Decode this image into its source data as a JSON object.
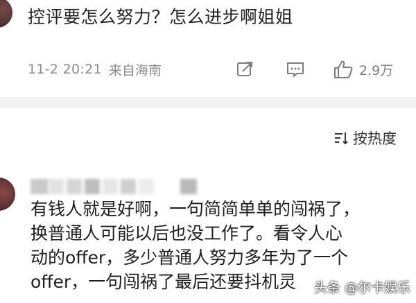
{
  "comment_top": {
    "text": "控评要怎么努力？怎么进步啊姐姐",
    "time": "11-2 20:21",
    "location": "来自海南",
    "like_count": "2.9万"
  },
  "sort": {
    "label": "按热度"
  },
  "comment_second": {
    "lines": [
      "有钱人就是好啊，一句简简单单的闯祸了，",
      "换普通人可能以后也没工作了。看令人心",
      "动的offer，多少普通人努力多年为了一个",
      "offer，一句闯祸了最后还要抖机灵"
    ]
  },
  "watermark": {
    "text": "头条 @尔卡娱乐"
  },
  "colors": {
    "meta_gray": "#8a8a8a",
    "divider": "#f2f2f2",
    "text": "#1f1f1f"
  }
}
